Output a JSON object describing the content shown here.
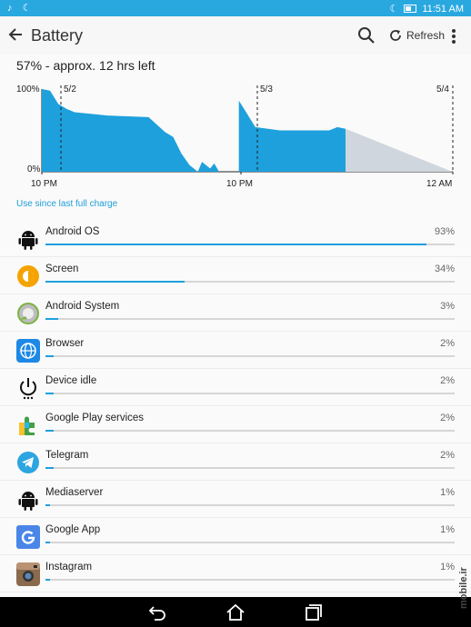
{
  "status_bar": {
    "left_icons": [
      "music-note-icon",
      "moon-icon"
    ],
    "right_icons": [
      "moon-icon",
      "battery-icon"
    ],
    "time": "11:51 AM"
  },
  "toolbar": {
    "title": "Battery",
    "refresh_label": "Refresh"
  },
  "summary": "57% - approx. 12 hrs left",
  "chart_labels": {
    "y_top": "100%",
    "y_bottom": "0%",
    "dates": [
      "5/2",
      "5/3",
      "5/4"
    ],
    "times": [
      "10 PM",
      "10 PM",
      "12 AM"
    ]
  },
  "chart_data": {
    "type": "area",
    "ylim": [
      0,
      100
    ],
    "series": [
      {
        "values_hours": [
          [
            0,
            100
          ],
          [
            1,
            98
          ],
          [
            2,
            82
          ],
          [
            3,
            76
          ],
          [
            4,
            72
          ],
          [
            8,
            68
          ],
          [
            13,
            66
          ],
          [
            15,
            48
          ],
          [
            16,
            42
          ],
          [
            17,
            22
          ],
          [
            18,
            8
          ],
          [
            19,
            0
          ],
          [
            19.5,
            12
          ],
          [
            20.5,
            4
          ],
          [
            21,
            10
          ],
          [
            21.6,
            0
          ]
        ]
      },
      {
        "values_hours": [
          [
            24,
            86
          ],
          [
            25,
            70
          ],
          [
            26,
            54
          ],
          [
            29,
            50
          ],
          [
            35,
            50
          ],
          [
            36,
            54
          ],
          [
            37,
            52
          ]
        ]
      },
      {
        "projection_hours": [
          [
            37,
            52
          ],
          [
            50,
            0
          ]
        ]
      }
    ],
    "colors": {
      "measured": "#1ea0dc",
      "projected": "#cfd6dd"
    }
  },
  "use_since_label": "Use since last full charge",
  "apps": [
    {
      "name": "Android OS",
      "pct_label": "93%",
      "pct": 93,
      "icon": "android-robot-icon"
    },
    {
      "name": "Screen",
      "pct_label": "34%",
      "pct": 34,
      "icon": "brightness-icon"
    },
    {
      "name": "Android System",
      "pct_label": "3%",
      "pct": 3,
      "icon": "android-system-icon"
    },
    {
      "name": "Browser",
      "pct_label": "2%",
      "pct": 2,
      "icon": "globe-icon"
    },
    {
      "name": "Device idle",
      "pct_label": "2%",
      "pct": 2,
      "icon": "power-icon"
    },
    {
      "name": "Google Play services",
      "pct_label": "2%",
      "pct": 2,
      "icon": "puzzle-icon"
    },
    {
      "name": "Telegram",
      "pct_label": "2%",
      "pct": 2,
      "icon": "telegram-icon"
    },
    {
      "name": "Mediaserver",
      "pct_label": "1%",
      "pct": 1,
      "icon": "android-robot-icon"
    },
    {
      "name": "Google App",
      "pct_label": "1%",
      "pct": 1,
      "icon": "google-g-icon"
    },
    {
      "name": "Instagram",
      "pct_label": "1%",
      "pct": 1,
      "icon": "instagram-icon"
    }
  ],
  "navbar": {
    "icons": [
      "back-icon",
      "home-icon",
      "recents-icon"
    ]
  },
  "watermark": "mobile.ir"
}
